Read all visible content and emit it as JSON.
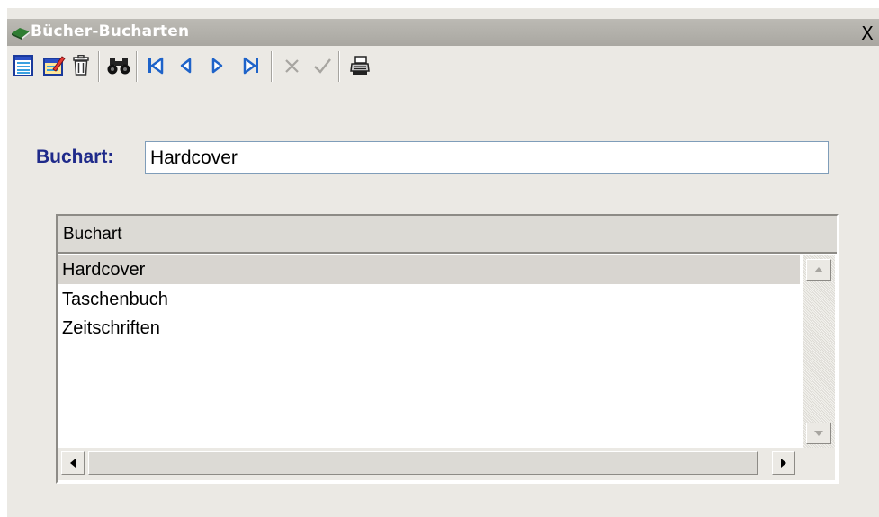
{
  "window": {
    "title": "Bücher-Bucharten",
    "close_label": "X"
  },
  "toolbar": {
    "buttons": [
      {
        "name": "new-record-icon"
      },
      {
        "name": "edit-record-icon"
      },
      {
        "name": "delete-icon"
      },
      {
        "name": "search-binoculars-icon"
      },
      {
        "name": "first-record-icon"
      },
      {
        "name": "previous-record-icon"
      },
      {
        "name": "next-record-icon"
      },
      {
        "name": "last-record-icon"
      },
      {
        "name": "cancel-icon"
      },
      {
        "name": "confirm-icon"
      },
      {
        "name": "print-icon"
      }
    ]
  },
  "form": {
    "label": "Buchart:",
    "value": "Hardcover"
  },
  "grid": {
    "column_header": "Buchart",
    "rows": [
      "Hardcover",
      "Taschenbuch",
      "Zeitschriften"
    ],
    "selected_index": 0
  },
  "colors": {
    "label_color": "#1f2a8a",
    "titlebar": "#b2b0aa",
    "selection": "#d8d5d0"
  }
}
